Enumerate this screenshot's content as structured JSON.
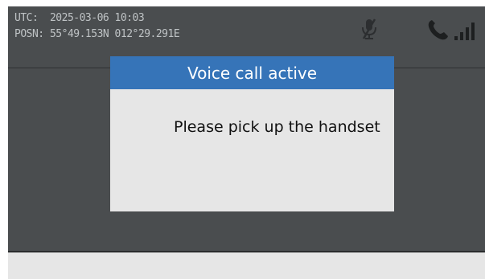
{
  "status": {
    "utc_label": "UTC:",
    "utc_value": "2025-03-06 10:03",
    "posn_label": "POSN:",
    "posn_value": "55°49.153N 012°29.291E",
    "icons": [
      "microphone-muted-icon",
      "phone-icon",
      "signal-bars-icon"
    ]
  },
  "dialog": {
    "title": "Voice call active",
    "message": "Please pick up the handset"
  },
  "colors": {
    "screen_bg": "#4a4d4f",
    "dialog_header": "#3674b8",
    "dialog_bg": "#e6e6e6",
    "status_text": "#bfc3c5"
  }
}
